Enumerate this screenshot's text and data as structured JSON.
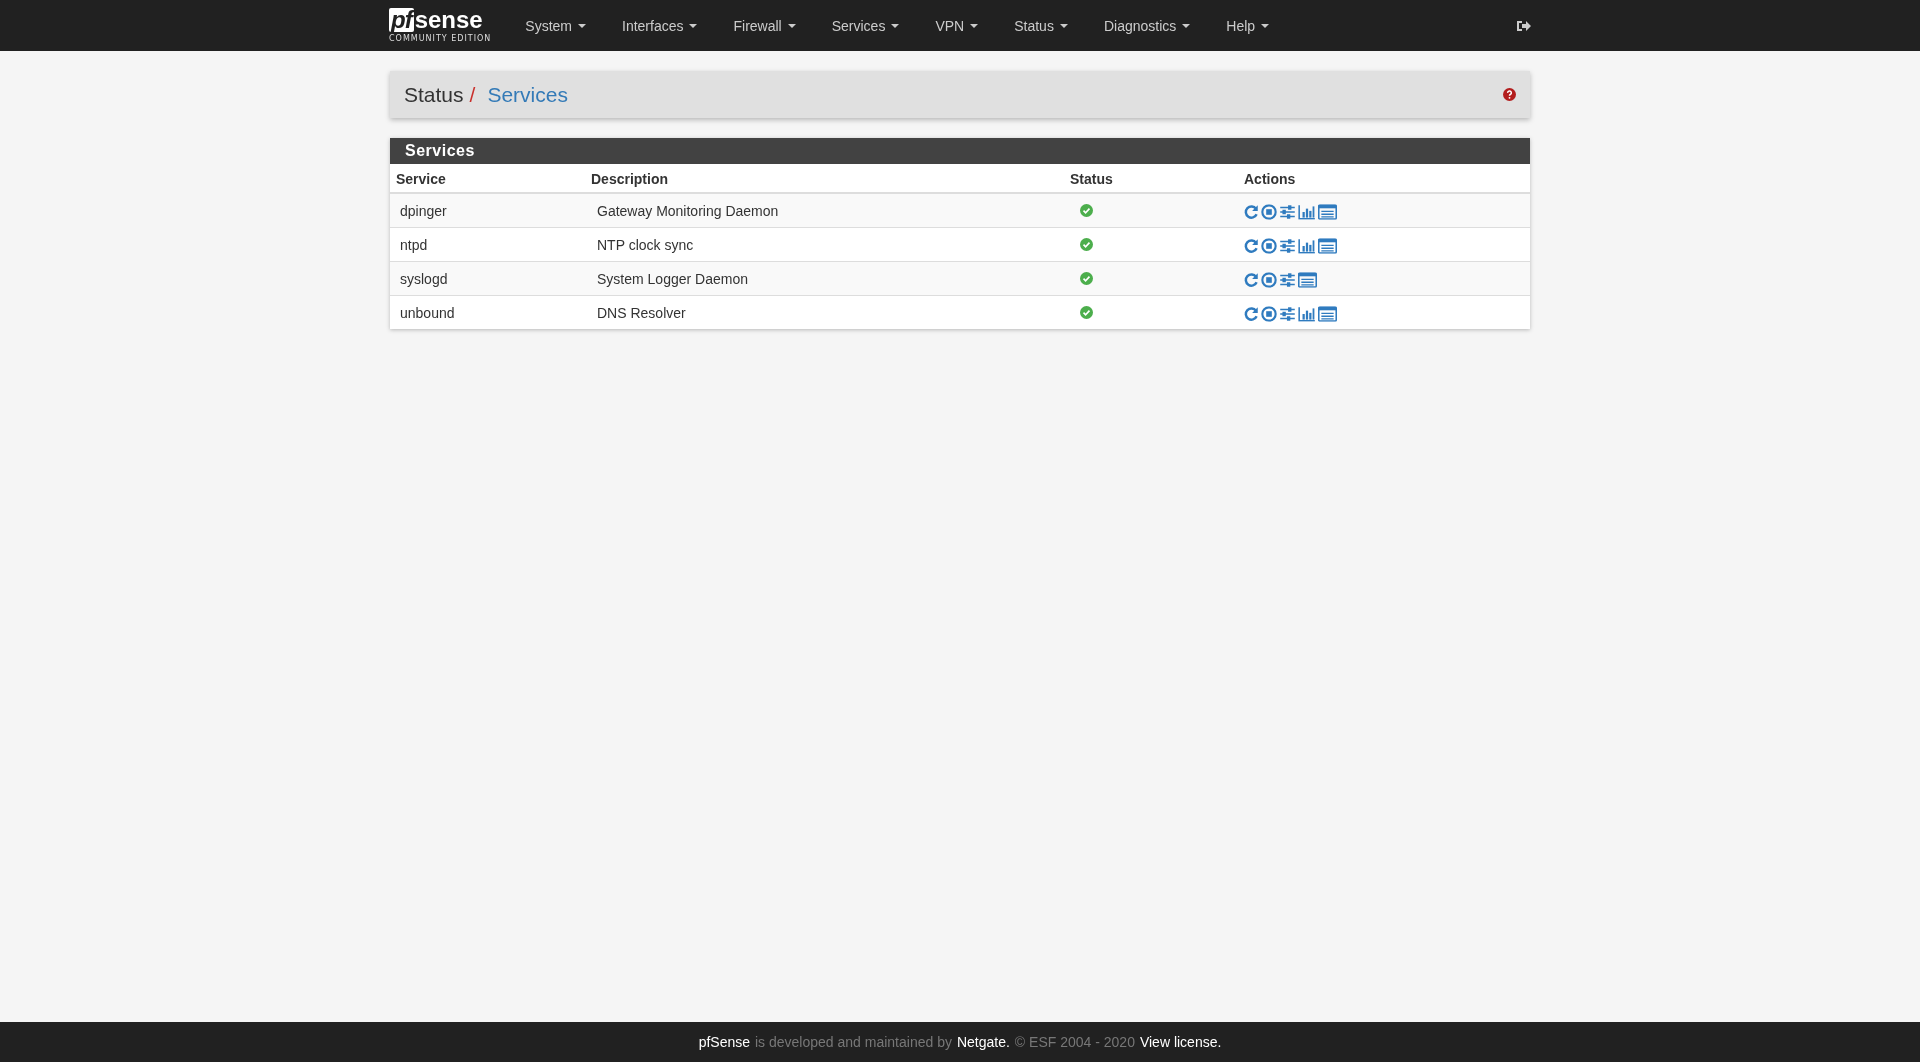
{
  "logo": {
    "mark": "pf",
    "word": "sense",
    "edition": "COMMUNITY EDITION"
  },
  "menu": [
    {
      "label": "System"
    },
    {
      "label": "Interfaces"
    },
    {
      "label": "Firewall"
    },
    {
      "label": "Services"
    },
    {
      "label": "VPN"
    },
    {
      "label": "Status"
    },
    {
      "label": "Diagnostics"
    },
    {
      "label": "Help"
    }
  ],
  "breadcrumb": {
    "parent": "Status",
    "separator": "/",
    "current": "Services"
  },
  "panel": {
    "title": "Services",
    "columns": [
      "Service",
      "Description",
      "Status",
      "Actions"
    ],
    "rows": [
      {
        "service": "dpinger",
        "description": "Gateway Monitoring Daemon",
        "running": true,
        "actions": [
          {
            "kind": "restart"
          },
          {
            "kind": "stop"
          },
          {
            "kind": "settings"
          },
          {
            "kind": "graph"
          },
          {
            "kind": "log"
          }
        ]
      },
      {
        "service": "ntpd",
        "description": "NTP clock sync",
        "running": true,
        "actions": [
          {
            "kind": "restart"
          },
          {
            "kind": "stop"
          },
          {
            "kind": "settings"
          },
          {
            "kind": "graph"
          },
          {
            "kind": "log"
          }
        ]
      },
      {
        "service": "syslogd",
        "description": "System Logger Daemon",
        "running": true,
        "actions": [
          {
            "kind": "restart"
          },
          {
            "kind": "stop"
          },
          {
            "kind": "settings"
          },
          {
            "kind": "log"
          }
        ]
      },
      {
        "service": "unbound",
        "description": "DNS Resolver",
        "running": true,
        "actions": [
          {
            "kind": "restart"
          },
          {
            "kind": "stop"
          },
          {
            "kind": "settings"
          },
          {
            "kind": "graph"
          },
          {
            "kind": "log"
          }
        ]
      }
    ]
  },
  "footer": [
    {
      "text": "pfSense",
      "kind": "strong"
    },
    {
      "text": "is developed and maintained by",
      "kind": "muted"
    },
    {
      "text": "Netgate.",
      "kind": "link"
    },
    {
      "text": "© ESF 2004 - 2020",
      "kind": "muted"
    },
    {
      "text": "View license.",
      "kind": "link"
    }
  ]
}
